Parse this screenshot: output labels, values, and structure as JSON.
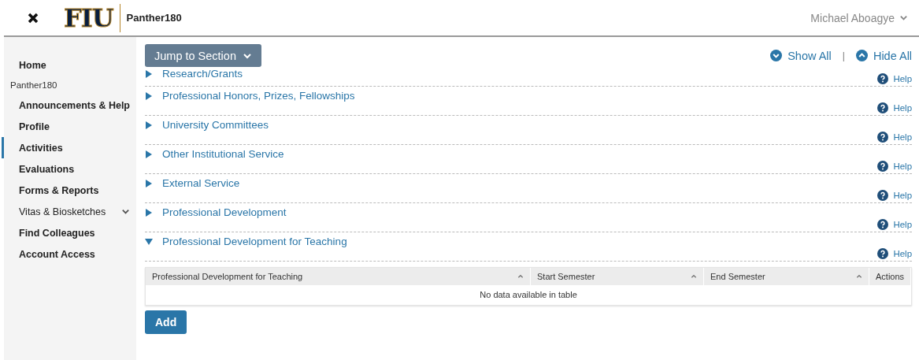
{
  "header": {
    "logo": "FIU",
    "app_name": "Panther180",
    "user": "Michael Aboagye"
  },
  "sidebar": {
    "items": [
      {
        "label": "Home",
        "kind": "link",
        "selected": false
      },
      {
        "label": "Panther180",
        "kind": "heading"
      },
      {
        "label": "Announcements & Help",
        "kind": "link",
        "selected": false
      },
      {
        "label": "Profile",
        "kind": "link",
        "selected": false
      },
      {
        "label": "Activities",
        "kind": "link",
        "selected": true
      },
      {
        "label": "Evaluations",
        "kind": "link",
        "selected": false
      },
      {
        "label": "Forms & Reports",
        "kind": "link",
        "selected": false
      },
      {
        "label": "Vitas & Biosketches",
        "kind": "group",
        "expanded": false
      },
      {
        "label": "Find Colleagues",
        "kind": "link",
        "selected": false
      },
      {
        "label": "Account Access",
        "kind": "link",
        "selected": false
      }
    ]
  },
  "toolbar": {
    "jump_button": "Jump to Section",
    "show_all": "Show All",
    "separator": "|",
    "hide_all": "Hide All"
  },
  "sections": [
    {
      "title": "Research/Grants",
      "help": "Help",
      "expanded": false
    },
    {
      "title": "Professional Honors, Prizes, Fellowships",
      "help": "Help",
      "expanded": false
    },
    {
      "title": "University Committees",
      "help": "Help",
      "expanded": false
    },
    {
      "title": "Other Institutional Service",
      "help": "Help",
      "expanded": false
    },
    {
      "title": "External Service",
      "help": "Help",
      "expanded": false
    },
    {
      "title": "Professional Development",
      "help": "Help",
      "expanded": false
    },
    {
      "title": "Professional Development for Teaching",
      "help": "Help",
      "expanded": true,
      "table": {
        "columns": [
          "Professional Development for Teaching",
          "Start Semester",
          "End Semester",
          "Actions"
        ],
        "empty_message": "No data available in table"
      },
      "add_button": "Add"
    }
  ]
}
